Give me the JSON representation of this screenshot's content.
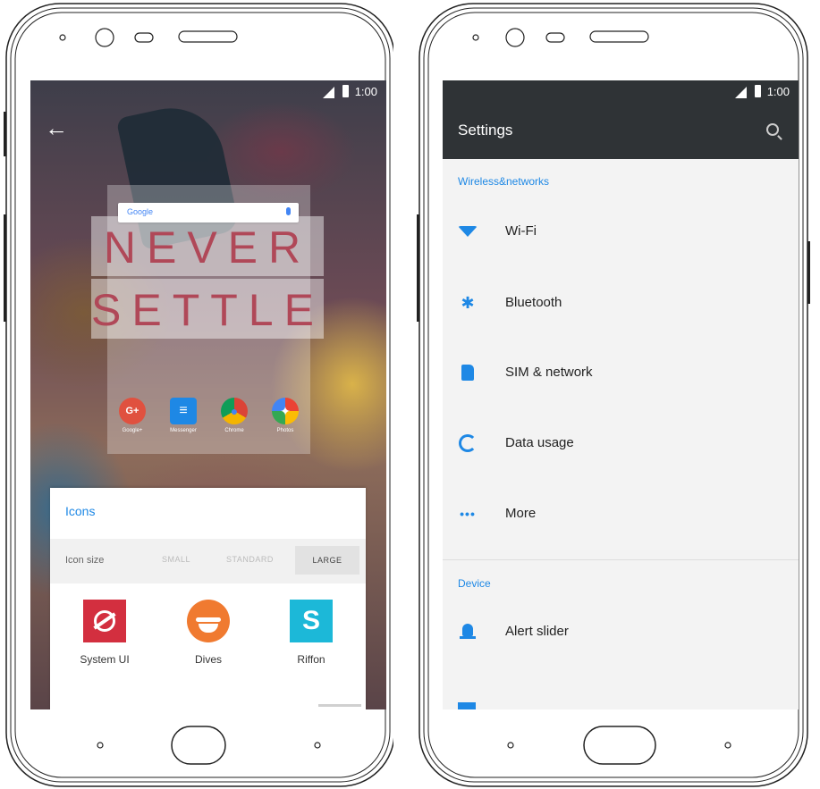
{
  "left_phone": {
    "status": {
      "time": "1:00"
    },
    "preview": {
      "search_logo": "Google",
      "wallpaper_lines": [
        "NEVER",
        "SETTLE"
      ],
      "dock_apps": [
        {
          "label": "Google+",
          "color": "#e0513f",
          "glyph": "G+"
        },
        {
          "label": "Messenger",
          "color": "#1e88e5",
          "glyph": "≡"
        },
        {
          "label": "Chrome",
          "color": "#f4b400",
          "glyph": "●"
        },
        {
          "label": "Photos",
          "color": "#34a853",
          "glyph": "✦"
        }
      ]
    },
    "icons_panel": {
      "title": "Icons",
      "size_label": "Icon size",
      "size_options": [
        "SMALL",
        "STANDARD",
        "LARGE"
      ],
      "selected_size": "LARGE",
      "packs": [
        {
          "label": "System UI",
          "color": "#d32f3f"
        },
        {
          "label": "Dives",
          "color": "#f07a30"
        },
        {
          "label": "Riffon",
          "color": "#1cb8d8"
        }
      ]
    }
  },
  "right_phone": {
    "status": {
      "time": "1:00"
    },
    "header": {
      "title": "Settings",
      "search_icon": "search-icon"
    },
    "sections": [
      {
        "title": "Wireless&networks",
        "items": [
          {
            "label": "Wi-Fi",
            "icon": "wifi-icon"
          },
          {
            "label": "Bluetooth",
            "icon": "bluetooth-icon"
          },
          {
            "label": "SIM & network",
            "icon": "sim-card-icon"
          },
          {
            "label": "Data usage",
            "icon": "data-usage-icon"
          },
          {
            "label": "More",
            "icon": "more-icon"
          }
        ]
      },
      {
        "title": "Device",
        "items": [
          {
            "label": "Alert slider",
            "icon": "bell-icon"
          }
        ]
      }
    ]
  },
  "colors": {
    "accent": "#1e88e5",
    "settings_header": "#2f3336",
    "settings_bg": "#f3f3f3"
  }
}
